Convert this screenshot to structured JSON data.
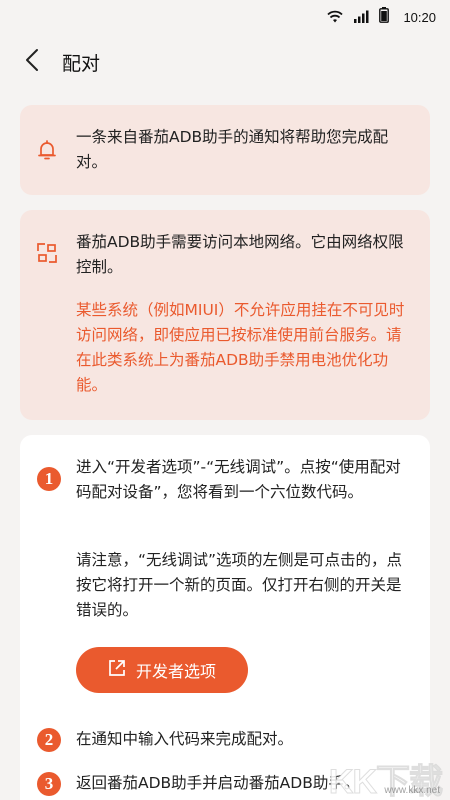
{
  "status_bar": {
    "time": "10:20",
    "icons": [
      "wifi-icon",
      "signal-icon",
      "battery-icon"
    ]
  },
  "header": {
    "title": "配对",
    "back_icon": "chevron-left-icon"
  },
  "notice_card": {
    "icon": "bell-icon",
    "text": "一条来自番茄ADB助手的通知将帮助您完成配对。"
  },
  "network_card": {
    "icon": "network-icon",
    "text": "番茄ADB助手需要访问本地网络。它由网络权限控制。",
    "warning": "某些系统（例如MIUI）不允许应用挂在不可见时访问网络，即使应用已按标准使用前台服务。请在此类系统上为番茄ADB助手禁用电池优化功能。"
  },
  "steps": [
    {
      "number": "1",
      "text": "进入“开发者选项”-“无线调试”。点按“使用配对码配对设备”，您将看到一个六位数代码。",
      "warning": "请注意，“无线调试”选项的左侧是可点击的，点按它将打开一个新的页面。仅打开右侧的开关是错误的。",
      "button_label": "开发者选项",
      "button_icon": "open-external-icon"
    },
    {
      "number": "2",
      "text": "在通知中输入代码来完成配对。"
    },
    {
      "number": "3",
      "text": "返回番茄ADB助手并启动番茄ADB助手。"
    }
  ],
  "colors": {
    "accent": "#ea5a2e",
    "pink_card": "#f7e6e1",
    "background": "#f5f3f2"
  },
  "watermark": {
    "text": "KK下载",
    "url": "www.kkx.net"
  }
}
